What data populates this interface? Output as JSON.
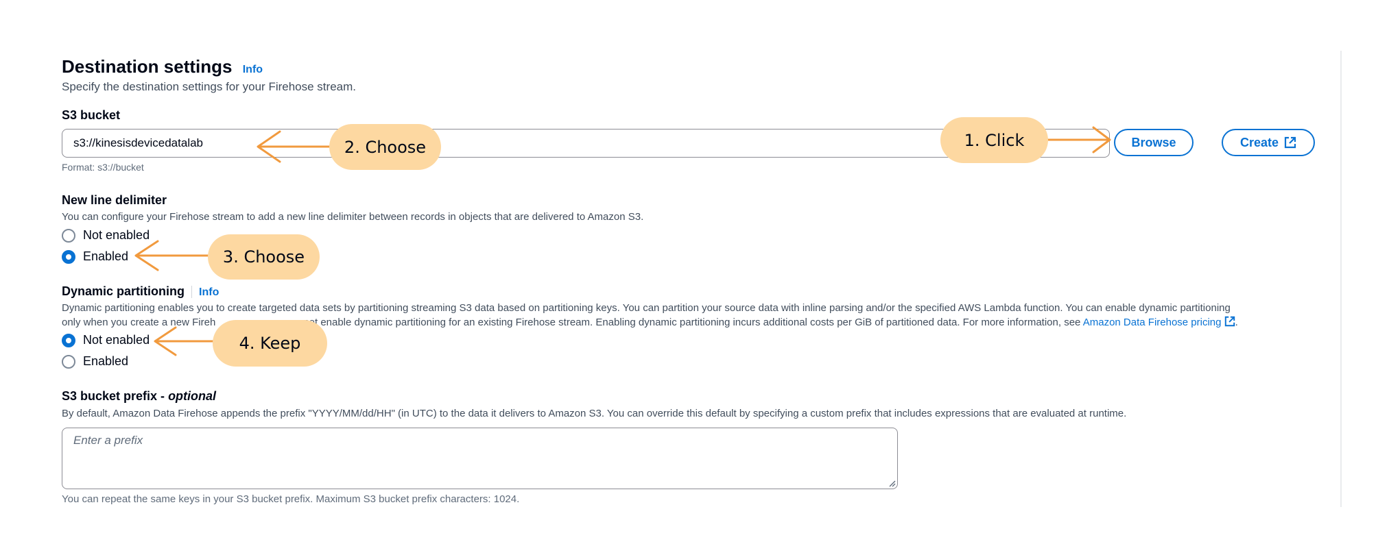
{
  "section": {
    "title": "Destination settings",
    "info_label": "Info",
    "description": "Specify the destination settings for your Firehose stream."
  },
  "s3_bucket": {
    "label": "S3 bucket",
    "value": "s3://kinesisdevicedatalab",
    "format_hint": "Format: s3://bucket",
    "browse_label": "Browse",
    "create_label": "Create"
  },
  "new_line_delimiter": {
    "label": "New line delimiter",
    "description": "You can configure your Firehose stream to add a new line delimiter between records in objects that are delivered to Amazon S3.",
    "options": [
      "Not enabled",
      "Enabled"
    ],
    "selected": "Enabled"
  },
  "dynamic_partitioning": {
    "label": "Dynamic partitioning",
    "info_label": "Info",
    "description_line1": "Dynamic partitioning enables you to create targeted data sets by partitioning streaming S3 data based on partitioning keys. You can partition your source data with inline parsing and/or the specified AWS Lambda function. You can enable dynamic partitioning",
    "description_line2_start": "only when you create a new Fireh",
    "description_line2_rest": "not enable dynamic partitioning for an existing Firehose stream. Enabling dynamic partitioning incurs additional costs per GiB of partitioned data. For more information, see",
    "pricing_link": "Amazon Data Firehose pricing",
    "options": [
      "Not enabled",
      "Enabled"
    ],
    "selected": "Not enabled"
  },
  "s3_prefix": {
    "label": "S3 bucket prefix - ",
    "label_optional": "optional",
    "description": "By default, Amazon Data Firehose appends the prefix \"YYYY/MM/dd/HH\" (in UTC) to the data it delivers to Amazon S3. You can override this default by specifying a custom prefix that includes expressions that are evaluated at runtime.",
    "placeholder": "Enter a prefix",
    "hint": "You can repeat the same keys in your S3 bucket prefix. Maximum S3 bucket prefix characters: 1024."
  },
  "annotations": {
    "step1": "1. Click",
    "step2": "2. Choose",
    "step3": "3. Choose",
    "step4": "4. Keep",
    "color": "#fdd8a1",
    "arrow_color": "#f19a3e"
  },
  "colors": {
    "accent": "#0972d3",
    "text": "#000716",
    "muted": "#414d5c"
  },
  "icons": [
    "external-link-icon",
    "resize-grip-icon"
  ]
}
